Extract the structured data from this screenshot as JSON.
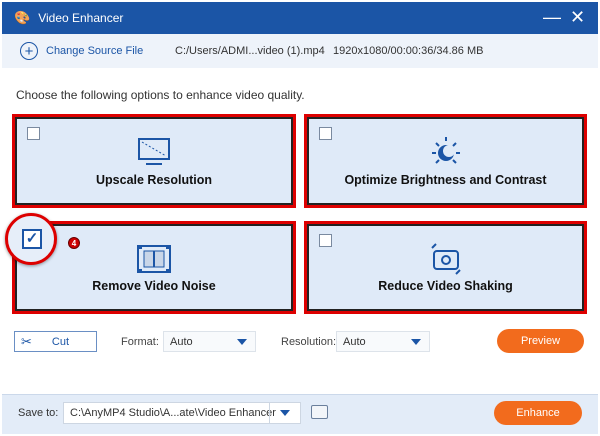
{
  "window": {
    "title": "Video Enhancer",
    "icon": "palette-icon"
  },
  "source": {
    "change_label": "Change Source File",
    "path": "C:/Users/ADMI...video (1).mp4",
    "info": "1920x1080/00:00:36/34.86 MB"
  },
  "intro": "Choose the following options to enhance video quality.",
  "options": [
    {
      "label": "Upscale Resolution",
      "checked": false,
      "icon": "upscale-monitor-icon"
    },
    {
      "label": "Optimize Brightness and Contrast",
      "checked": false,
      "icon": "brightness-icon"
    },
    {
      "label": "Remove Video Noise",
      "checked": true,
      "icon": "film-icon"
    },
    {
      "label": "Reduce Video Shaking",
      "checked": false,
      "icon": "stabilize-camera-icon"
    }
  ],
  "annotation_badge": "4",
  "controls": {
    "cut_label": "Cut",
    "format_label": "Format:",
    "format_value": "Auto",
    "resolution_label": "Resolution:",
    "resolution_value": "Auto",
    "preview_label": "Preview"
  },
  "footer": {
    "save_label": "Save to:",
    "save_path": "C:\\AnyMP4 Studio\\A...ate\\Video Enhancer",
    "enhance_label": "Enhance"
  },
  "colors": {
    "title_bar": "#1b55a6",
    "accent_orange": "#f26b1d",
    "highlight_red": "#dd0000"
  }
}
